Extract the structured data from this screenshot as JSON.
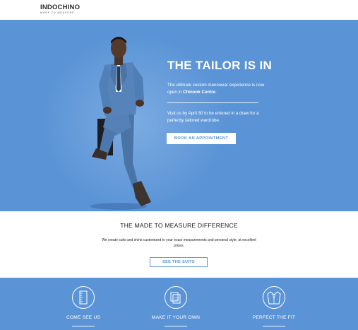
{
  "header": {
    "logo_main": "INDOCHINO",
    "logo_sub": "MADE TO MEASURE"
  },
  "hero": {
    "title": "THE TAILOR IS IN",
    "intro_text": "The ultimate custom menswear experience is now open in ",
    "intro_location": "Chinook Centre",
    "intro_end": ".",
    "promo_text": "Visit us by April 30 to be entered in a draw for a perfectly tailored wardrobe.",
    "cta_label": "BOOK AN APPOINTMENT"
  },
  "difference": {
    "title": "THE MADE TO MEASURE DIFFERENCE",
    "text": "We create suits and shirts customized to your exact measurements and personal style, at excellent prices.",
    "cta_label": "SEE THE SUITS"
  },
  "features": [
    {
      "label": "COME SEE US",
      "icon": "measuring-tape-icon"
    },
    {
      "label": "MAKE IT YOUR OWN",
      "icon": "fabric-swatches-icon"
    },
    {
      "label": "PERFECT THE FIT",
      "icon": "suit-jacket-icon"
    }
  ],
  "colors": {
    "brand_blue": "#5b94d6",
    "white": "#ffffff",
    "suit_blue": "#4f79ad"
  }
}
